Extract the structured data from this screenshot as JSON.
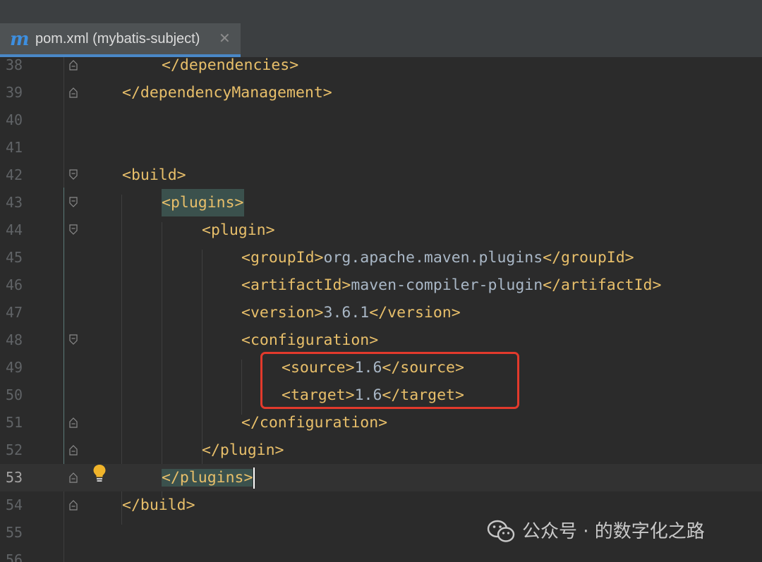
{
  "tab": {
    "icon_letter": "m",
    "label": "pom.xml (mybatis-subject)",
    "close_glyph": "✕"
  },
  "editor": {
    "current_line": "53",
    "lines": [
      {
        "num": "38",
        "tag": "</dependencies>"
      },
      {
        "num": "39",
        "tag": "</dependencyManagement>"
      },
      {
        "num": "40"
      },
      {
        "num": "41"
      },
      {
        "num": "42",
        "tag": "<build>"
      },
      {
        "num": "43",
        "tag": "<plugins>"
      },
      {
        "num": "44",
        "tag": "<plugin>"
      },
      {
        "num": "45",
        "open": "<groupId>",
        "text": "org.apache.maven.plugins",
        "close": "</groupId>"
      },
      {
        "num": "46",
        "open": "<artifactId>",
        "text": "maven-compiler-plugin",
        "close": "</artifactId>"
      },
      {
        "num": "47",
        "open": "<version>",
        "text": "3.6.1",
        "close": "</version>"
      },
      {
        "num": "48",
        "tag": "<configuration>"
      },
      {
        "num": "49",
        "open": "<source>",
        "text": "1.6",
        "close": "</source>"
      },
      {
        "num": "50",
        "open": "<target>",
        "text": "1.6",
        "close": "</target>"
      },
      {
        "num": "51",
        "tag": "</configuration>"
      },
      {
        "num": "52",
        "tag": "</plugin>"
      },
      {
        "num": "53",
        "tag": "</plugins>"
      },
      {
        "num": "54",
        "tag": "</build>"
      },
      {
        "num": "55"
      },
      {
        "num": "56"
      }
    ]
  },
  "watermark": {
    "icon": "wechat-icon",
    "text": "公众号 · 的数字化之路"
  },
  "colors": {
    "tag": "#e8bf6a",
    "text": "#a9b7c6",
    "highlight": "#3b514d",
    "annotation_box": "#e23a2c"
  }
}
